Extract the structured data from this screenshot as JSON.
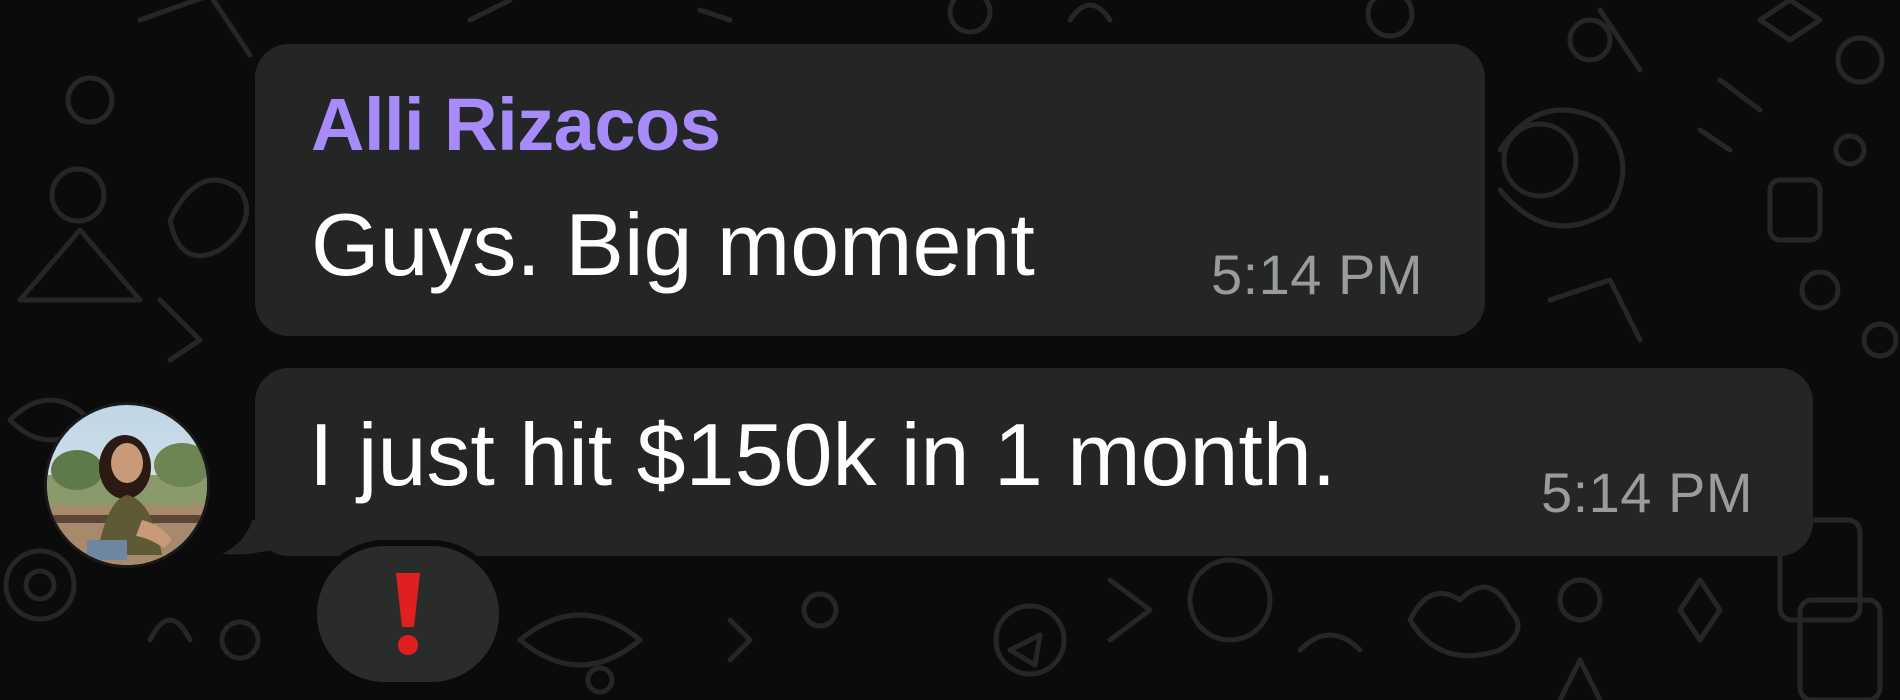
{
  "conversation": {
    "messages": [
      {
        "sender": "Alli Rizacos",
        "text": "Guys. Big moment",
        "time": "5:14 PM"
      },
      {
        "text": "I just hit $150k in 1 month.",
        "time": "5:14 PM",
        "reaction": "red-exclamation-mark"
      }
    ]
  },
  "colors": {
    "background": "#0b0b0b",
    "bubble": "#242626",
    "sender_name": "#a78bfa",
    "message_text": "#ffffff",
    "timestamp": "#9a9c9c",
    "reaction_icon": "#e02020"
  },
  "icons": {
    "avatar": "sender-avatar-photo",
    "reaction": "red-exclamation-mark-icon"
  }
}
